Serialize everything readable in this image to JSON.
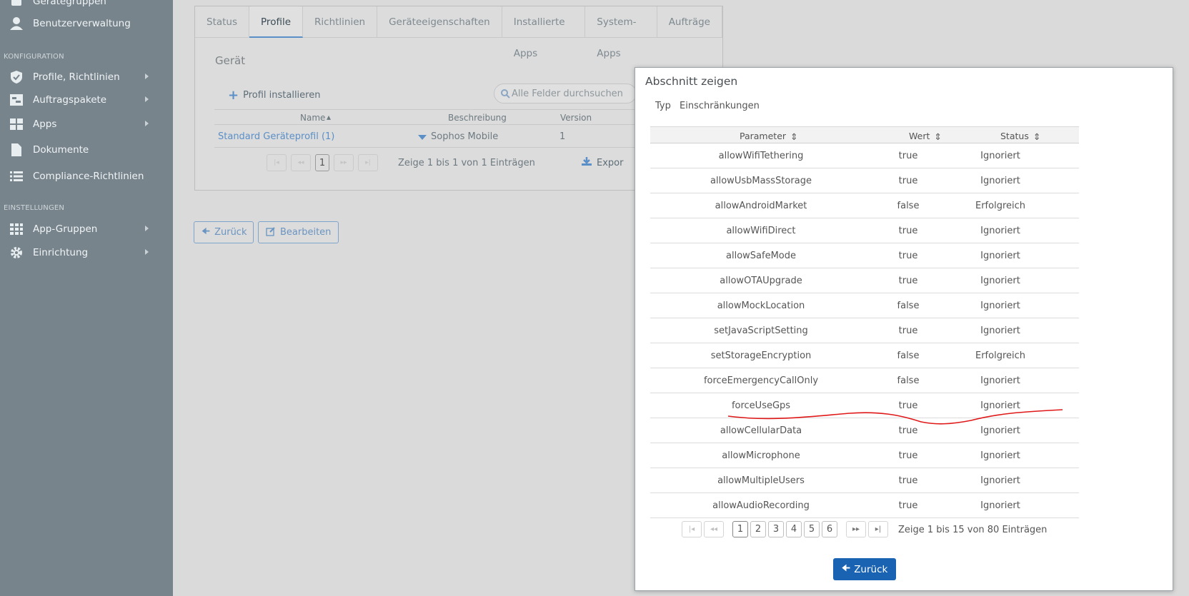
{
  "sidebar": {
    "top_item_partial": "Gerätegruppen",
    "benutzer": "Benutzerverwaltung",
    "heading_konfig": "KONFIGURATION",
    "items": [
      {
        "label": "Profile, Richtlinien"
      },
      {
        "label": "Auftragspakete"
      },
      {
        "label": "Apps"
      },
      {
        "label": "Dokumente"
      },
      {
        "label": "Compliance-Richtlinien"
      }
    ],
    "heading_einst": "EINSTELLUNGEN",
    "items2": [
      {
        "label": "App-Gruppen"
      },
      {
        "label": "Einrichtung"
      }
    ]
  },
  "tabs": [
    "Status",
    "Profile",
    "Richtlinien",
    "Geräteeigenschaften",
    "Installierte Apps",
    "System-Apps",
    "Aufträge"
  ],
  "device_panel": {
    "title": "Gerät",
    "install_label": "Profil installieren",
    "search_placeholder": "Alle Felder durchsuchen",
    "columns": [
      "Name",
      "Beschreibung",
      "Version"
    ],
    "row": {
      "name": "Standard Geräteprofil (1)",
      "description": "Sophos Mobile",
      "version": "1"
    },
    "pager_current": "1",
    "pager_info": "Zeige 1 bis 1 von 1 Einträgen",
    "export_label": "Expor"
  },
  "buttons": {
    "back": "Zurück",
    "edit": "Bearbeiten"
  },
  "modal": {
    "title": "Abschnitt zeigen",
    "typ_label": "Typ",
    "typ_value": "Einschränkungen",
    "columns": {
      "parameter": "Parameter",
      "wert": "Wert",
      "status": "Status"
    },
    "rows": [
      {
        "parameter": "allowWifiTethering",
        "wert": "true",
        "status": "Ignoriert"
      },
      {
        "parameter": "allowUsbMassStorage",
        "wert": "true",
        "status": "Ignoriert"
      },
      {
        "parameter": "allowAndroidMarket",
        "wert": "false",
        "status": "Erfolgreich"
      },
      {
        "parameter": "allowWifiDirect",
        "wert": "true",
        "status": "Ignoriert"
      },
      {
        "parameter": "allowSafeMode",
        "wert": "true",
        "status": "Ignoriert"
      },
      {
        "parameter": "allowOTAUpgrade",
        "wert": "true",
        "status": "Ignoriert"
      },
      {
        "parameter": "allowMockLocation",
        "wert": "false",
        "status": "Ignoriert"
      },
      {
        "parameter": "setJavaScriptSetting",
        "wert": "true",
        "status": "Ignoriert"
      },
      {
        "parameter": "setStorageEncryption",
        "wert": "false",
        "status": "Erfolgreich"
      },
      {
        "parameter": "forceEmergencyCallOnly",
        "wert": "false",
        "status": "Ignoriert"
      },
      {
        "parameter": "forceUseGps",
        "wert": "true",
        "status": "Ignoriert"
      },
      {
        "parameter": "allowCellularData",
        "wert": "true",
        "status": "Ignoriert"
      },
      {
        "parameter": "allowMicrophone",
        "wert": "true",
        "status": "Ignoriert"
      },
      {
        "parameter": "allowMultipleUsers",
        "wert": "true",
        "status": "Ignoriert"
      },
      {
        "parameter": "allowAudioRecording",
        "wert": "true",
        "status": "Ignoriert"
      }
    ],
    "pages": [
      "1",
      "2",
      "3",
      "4",
      "5",
      "6"
    ],
    "pager_info": "Zeige 1 bis 15 von 80 Einträgen",
    "back_label": "Zurück"
  },
  "colors": {
    "accent": "#1a63b3",
    "sidebar": "#77848c",
    "annotation": "#e01818"
  }
}
